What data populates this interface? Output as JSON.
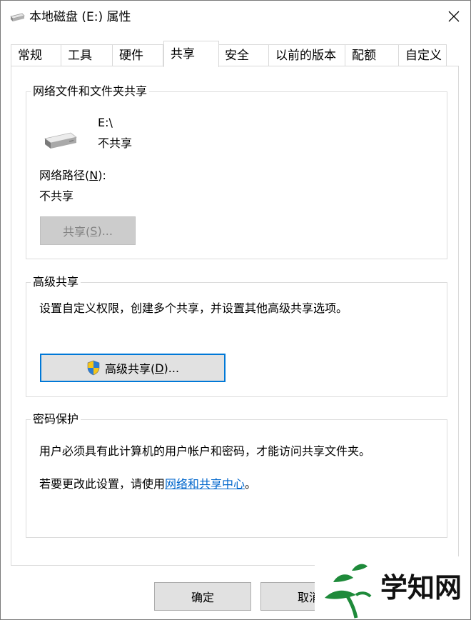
{
  "window": {
    "title": "本地磁盘 (E:) 属性"
  },
  "tabs": [
    {
      "label": "常规"
    },
    {
      "label": "工具"
    },
    {
      "label": "硬件"
    },
    {
      "label": "共享"
    },
    {
      "label": "安全"
    },
    {
      "label": "以前的版本"
    },
    {
      "label": "配额"
    },
    {
      "label": "自定义"
    }
  ],
  "active_tab": "共享",
  "network_sharing": {
    "group_title": "网络文件和文件夹共享",
    "drive_path": "E:\\",
    "drive_status": "不共享",
    "network_path_label_prefix": "网络路径(",
    "network_path_label_key": "N",
    "network_path_label_suffix": "):",
    "network_path_value": "不共享",
    "share_button_prefix": "共享(",
    "share_button_key": "S",
    "share_button_suffix": ")..."
  },
  "advanced_sharing": {
    "group_title": "高级共享",
    "description": "设置自定义权限，创建多个共享，并设置其他高级共享选项。",
    "button_prefix": "高级共享(",
    "button_key": "D",
    "button_suffix": ")..."
  },
  "password_protection": {
    "group_title": "密码保护",
    "description": "用户必须具有此计算机的用户帐户和密码，才能访问共享文件夹。",
    "change_prefix": "若要更改此设置，请使用",
    "change_link": "网络和共享中心",
    "change_suffix": "。"
  },
  "footer": {
    "ok_label": "确定",
    "cancel_label": "取消"
  },
  "watermark": {
    "text": "学知网"
  },
  "colors": {
    "accent": "#0078d7",
    "link": "#0066cc",
    "watermark_green": "#1e8a3a"
  }
}
